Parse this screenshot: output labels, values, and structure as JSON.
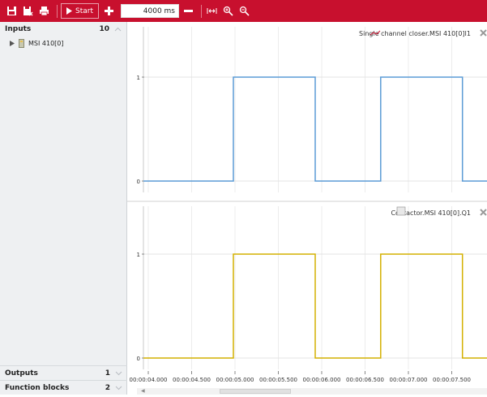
{
  "toolbar": {
    "start_label": "Start",
    "duration_value": "4000 ms",
    "icons": [
      "save-icon",
      "save-as-icon",
      "print-icon",
      "play-icon",
      "plus-icon",
      "minus-icon",
      "fit-to-window-icon",
      "zoom-in-icon",
      "zoom-out-icon"
    ],
    "accent_color": "#c8102e"
  },
  "sidebar": {
    "inputs": {
      "label": "Inputs",
      "count": "10"
    },
    "tree_items": [
      {
        "label": "MSI 410[0]"
      }
    ],
    "outputs": {
      "label": "Outputs",
      "count": "1"
    },
    "function_blocks": {
      "label": "Function blocks",
      "count": "2"
    }
  },
  "plots": [
    {
      "legend": "Single channel closer.MSI 410[0]I1",
      "color": "#5b9bd5",
      "icon": "input-signal-icon"
    },
    {
      "legend": "Contactor.MSI 410[0].Q1",
      "color": "#d4b000",
      "icon": "contactor-icon"
    }
  ],
  "x_ticks": [
    "00:00:04.000",
    "00:00:04.500",
    "00:00:05.000",
    "00:00:05.500",
    "00:00:06.000",
    "00:00:06.500",
    "00:00:07.000",
    "00:00:07.500"
  ],
  "y_ticks": [
    "1",
    "0"
  ],
  "chart_data": [
    {
      "type": "line",
      "x": [
        3.95,
        4.5,
        4.5,
        5.0,
        5.0,
        5.4,
        5.4,
        5.9,
        5.9,
        6.05
      ],
      "series": [
        {
          "name": "Single channel closer.MSI 410[0]I1",
          "values": [
            0,
            0,
            1,
            1,
            0,
            0,
            1,
            1,
            0,
            0
          ]
        }
      ],
      "xlabel": "",
      "ylabel": "",
      "ylim": [
        0,
        1
      ],
      "grid": true,
      "legend": "top-right"
    },
    {
      "type": "line",
      "x": [
        3.95,
        4.5,
        4.5,
        5.0,
        5.0,
        5.4,
        5.4,
        5.9,
        5.9,
        6.05
      ],
      "series": [
        {
          "name": "Contactor.MSI 410[0].Q1",
          "values": [
            0,
            0,
            1,
            1,
            0,
            0,
            1,
            1,
            0,
            0
          ]
        }
      ],
      "xlabel": "",
      "ylabel": "",
      "ylim": [
        0,
        1
      ],
      "grid": true,
      "legend": "top-right"
    }
  ]
}
